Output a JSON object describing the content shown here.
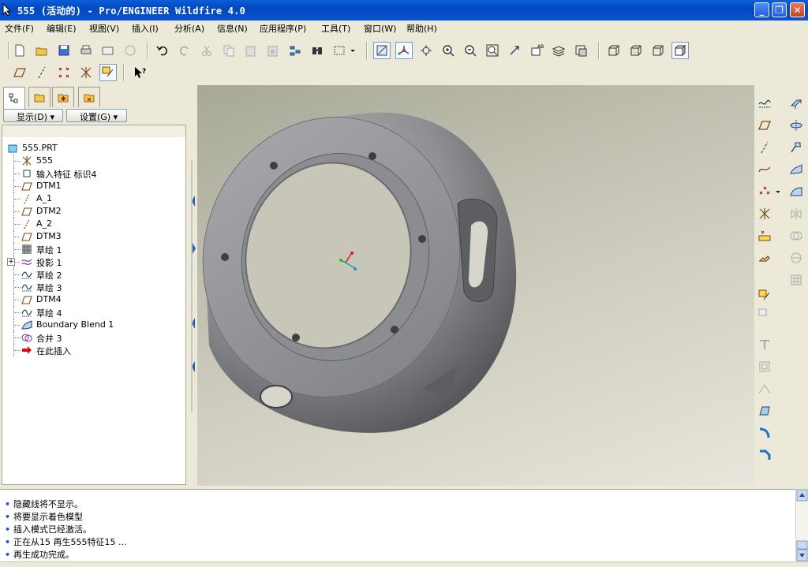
{
  "window": {
    "title": "555 (活动的) - Pro/ENGINEER Wildfire 4.0",
    "minimize": "_",
    "maximize": "❐",
    "close": "✕"
  },
  "menu": [
    "文件(F)",
    "编辑(E)",
    "视图(V)",
    "插入(I)",
    "分析(A)",
    "信息(N)",
    "应用程序(P)",
    "工具(T)",
    "窗口(W)",
    "帮助(H)"
  ],
  "navigator": {
    "show_button": "显示(D) ▾",
    "settings_button": "设置(G) ▾"
  },
  "model_tree": [
    {
      "label": "555.PRT",
      "icon": "part-icon",
      "expand": false
    },
    {
      "label": "555",
      "icon": "csys-icon",
      "expand": false
    },
    {
      "label": "输入特征 标识4",
      "icon": "import-feature-icon",
      "expand": false
    },
    {
      "label": "DTM1",
      "icon": "datum-plane-icon",
      "expand": false
    },
    {
      "label": "A_1",
      "icon": "datum-axis-icon",
      "expand": false
    },
    {
      "label": "DTM2",
      "icon": "datum-plane-icon",
      "expand": false
    },
    {
      "label": "A_2",
      "icon": "datum-axis-icon",
      "expand": false
    },
    {
      "label": "DTM3",
      "icon": "datum-plane-icon",
      "expand": false
    },
    {
      "label": "草绘 1",
      "icon": "sketch-icon",
      "expand": false
    },
    {
      "label": "投影 1",
      "icon": "projection-icon",
      "expand": true
    },
    {
      "label": "草绘 2",
      "icon": "sketch-curve-icon",
      "expand": false
    },
    {
      "label": "草绘 3",
      "icon": "sketch-curve-icon",
      "expand": false
    },
    {
      "label": "DTM4",
      "icon": "datum-plane-icon",
      "expand": false
    },
    {
      "label": "草绘 4",
      "icon": "sketch-curve-icon",
      "expand": false
    },
    {
      "label": "Boundary Blend 1",
      "icon": "boundary-blend-icon",
      "expand": false
    },
    {
      "label": "合并 3",
      "icon": "merge-icon",
      "expand": false
    },
    {
      "label": "在此插入",
      "icon": "insert-here-arrow-icon",
      "expand": false
    }
  ],
  "messages": [
    "隐藏线将不显示。",
    "将要显示着色模型",
    "插入模式已经激活。",
    "正在从15 再生555特征15 ...",
    "再生成功完成。"
  ],
  "colors": {
    "titlebar": "#0a53d0",
    "model_gray": "#8e8f92",
    "message_bullet": "#1a4fd0"
  }
}
